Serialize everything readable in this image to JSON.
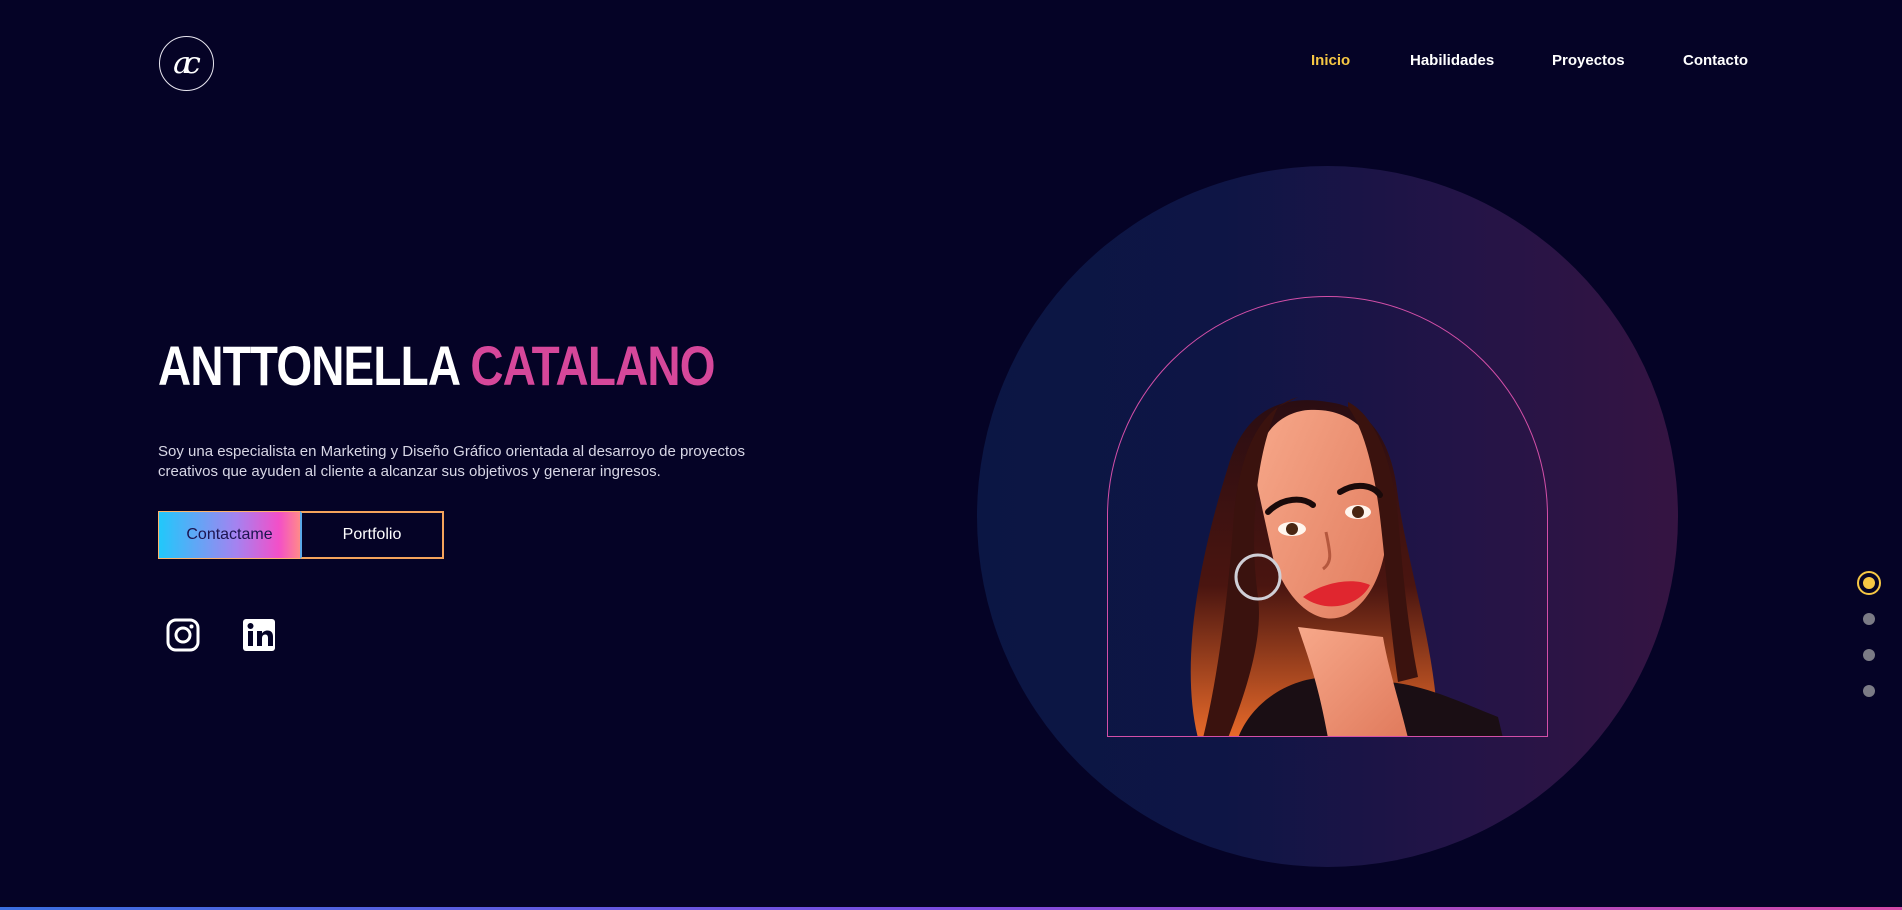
{
  "logo": {
    "text": "ac"
  },
  "nav": {
    "items": [
      {
        "label": "Inicio",
        "active": true
      },
      {
        "label": "Habilidades",
        "active": false
      },
      {
        "label": "Proyectos",
        "active": false
      },
      {
        "label": "Contacto",
        "active": false
      }
    ]
  },
  "hero": {
    "name_first": "ANTTONELLA",
    "name_last": "CATALANO",
    "description": "Soy una especialista en Marketing y Diseño Gráfico orientada al desarroyo de proyectos creativos que ayuden al cliente a alcanzar sus objetivos y generar ingresos.",
    "buttons": {
      "primary": "Contactame",
      "secondary": "Portfolio"
    },
    "social": [
      "instagram-icon",
      "linkedin-icon"
    ]
  },
  "section_dots": {
    "count": 4,
    "active_index": 0
  },
  "colors": {
    "background": "#050326",
    "accent_yellow": "#f6c744",
    "accent_pink": "#d6479a",
    "button_gradient_start": "#21c8fb",
    "button_gradient_end": "#f34fc8"
  }
}
